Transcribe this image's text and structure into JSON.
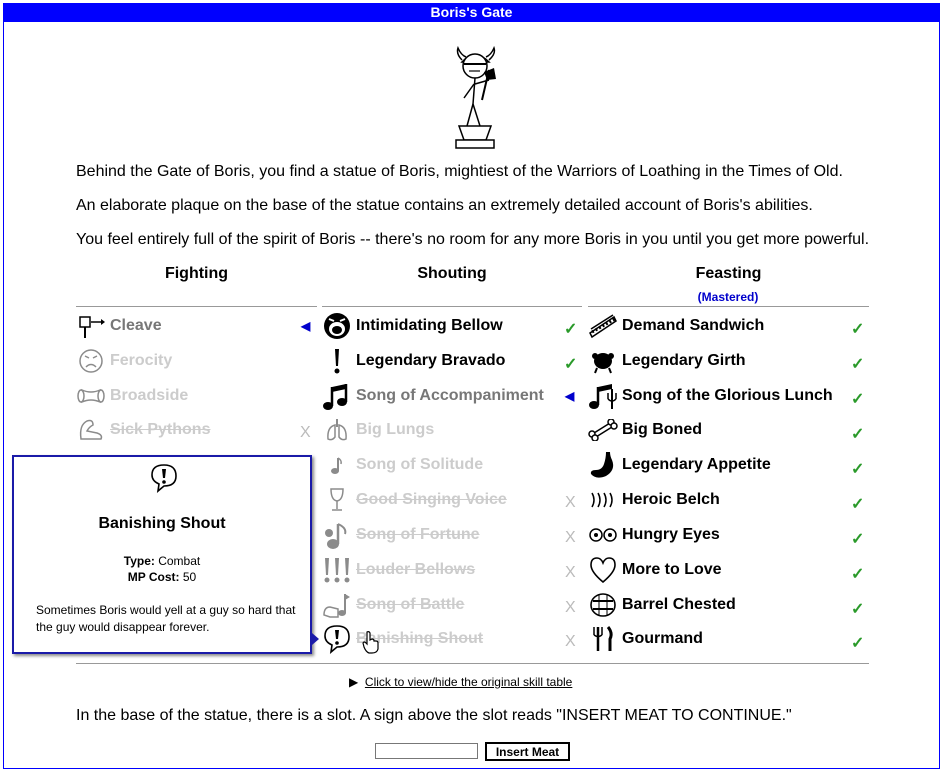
{
  "title": "Boris's Gate",
  "paragraphs": [
    "Behind the Gate of Boris, you find a statue of Boris, mightiest of the Warriors of Loathing in the Times of Old.",
    "An elaborate plaque on the base of the statue contains an extremely detailed account of Boris's abilities.",
    "You feel entirely full of the spirit of Boris -- there's no room for any more Boris in you until you get more powerful."
  ],
  "columns": {
    "fighting": {
      "heading": "Fighting",
      "skills": [
        {
          "name": "Cleave",
          "state": "current",
          "icon": "axe-icon"
        },
        {
          "name": "Ferocity",
          "state": "available",
          "icon": "angry-face-icon"
        },
        {
          "name": "Broadside",
          "state": "available",
          "icon": "scroll-icon"
        },
        {
          "name": "Sick Pythons",
          "state": "lost",
          "icon": "flexed-arm-icon"
        }
      ]
    },
    "shouting": {
      "heading": "Shouting",
      "skills": [
        {
          "name": "Intimidating Bellow",
          "state": "have",
          "icon": "shouting-face-icon"
        },
        {
          "name": "Legendary Bravado",
          "state": "have",
          "icon": "exclamation-icon"
        },
        {
          "name": "Song of Accompaniment",
          "state": "current",
          "icon": "music-notes-icon"
        },
        {
          "name": "Big Lungs",
          "state": "available",
          "icon": "lungs-icon"
        },
        {
          "name": "Song of Solitude",
          "state": "available",
          "icon": "single-note-icon"
        },
        {
          "name": "Good Singing Voice",
          "state": "lost",
          "icon": "goblet-icon"
        },
        {
          "name": "Song of Fortune",
          "state": "lost",
          "icon": "note-coin-icon"
        },
        {
          "name": "Louder Bellows",
          "state": "lost",
          "icon": "triple-exclamation-icon"
        },
        {
          "name": "Song of Battle",
          "state": "lost",
          "icon": "note-arm-icon"
        },
        {
          "name": "Banishing Shout",
          "state": "lost",
          "icon": "speech-exclamation-icon"
        }
      ]
    },
    "feasting": {
      "heading": "Feasting",
      "subheading": "(Mastered)",
      "skills": [
        {
          "name": "Demand Sandwich",
          "state": "have",
          "icon": "sandwich-icon"
        },
        {
          "name": "Legendary Girth",
          "state": "have",
          "icon": "turkey-icon"
        },
        {
          "name": "Song of the Glorious Lunch",
          "state": "have",
          "icon": "note-fork-icon"
        },
        {
          "name": "Big Boned",
          "state": "have",
          "icon": "bone-icon"
        },
        {
          "name": "Legendary Appetite",
          "state": "have",
          "icon": "stomach-icon"
        },
        {
          "name": "Heroic Belch",
          "state": "have",
          "icon": "belch-waves-icon"
        },
        {
          "name": "Hungry Eyes",
          "state": "have",
          "icon": "eyes-icon"
        },
        {
          "name": "More to Love",
          "state": "have",
          "icon": "heart-icon"
        },
        {
          "name": "Barrel Chested",
          "state": "have",
          "icon": "barrel-icon"
        },
        {
          "name": "Gourmand",
          "state": "have",
          "icon": "fork-knife-icon"
        }
      ]
    }
  },
  "marks": {
    "have": "✓",
    "lost": "X",
    "current": "◀"
  },
  "tooltip": {
    "name": "Banishing Shout",
    "type_label": "Type:",
    "type_value": "Combat",
    "mp_label": "MP Cost:",
    "mp_value": "50",
    "description": "Sometimes Boris would yell at a guy so hard that the guy would disappear forever."
  },
  "toggle_label": "Click to view/hide the original skill table",
  "toggle_arrow": "▶",
  "slot_text": "In the base of the statue, there is a slot. A sign above the slot reads \"INSERT MEAT TO CONTINUE.\"",
  "meat_input_value": "",
  "meat_button_label": "Insert Meat",
  "colors": {
    "title_bar": "#0000ff",
    "check": "#2a9a2a",
    "mastered": "#0000cc"
  }
}
